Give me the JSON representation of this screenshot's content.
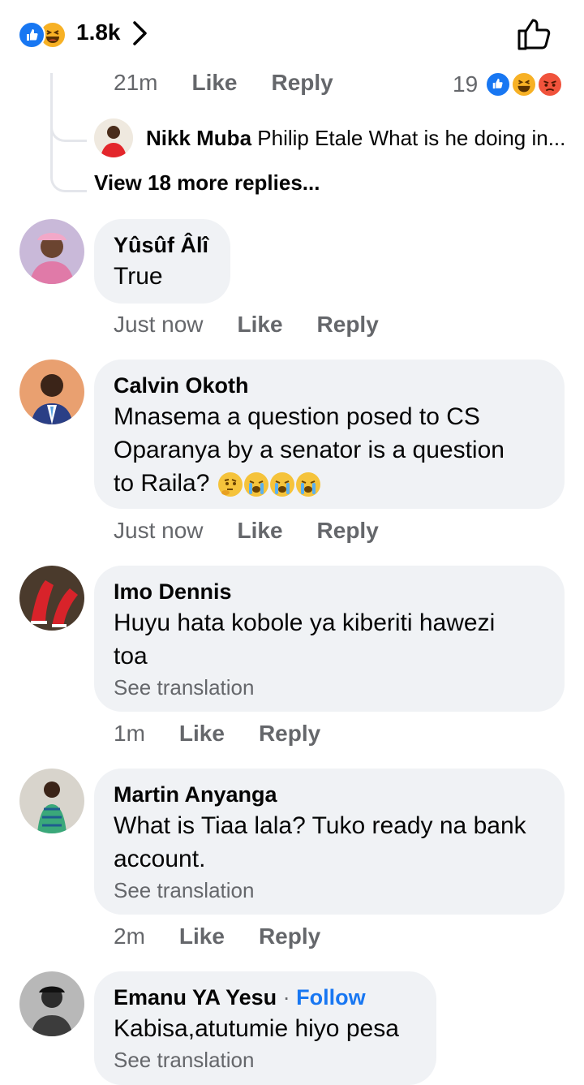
{
  "top": {
    "reaction_count": "1.8k"
  },
  "thread": {
    "time": "21m",
    "like": "Like",
    "reply": "Reply",
    "reaction_count": "19"
  },
  "nested_reply": {
    "name": "Nikk Muba",
    "text": "Philip Etale What is he doing in..."
  },
  "view_more": "View 18 more replies...",
  "comments": [
    {
      "name": "Yûsûf Âlî",
      "text": "True",
      "time": "Just now",
      "like": "Like",
      "reply": "Reply"
    },
    {
      "name": "Calvin Okoth",
      "text_line1": "Mnasema a question posed to CS",
      "text_line2": "Oparanya by a senator is a question",
      "text_line3": "to Raila?",
      "time": "Just now",
      "like": "Like",
      "reply": "Reply"
    },
    {
      "name": "Imo Dennis",
      "text_line1": "Huyu hata kobole ya kiberiti hawezi",
      "text_line2": "toa",
      "see_translation": "See translation",
      "time": "1m",
      "like": "Like",
      "reply": "Reply"
    },
    {
      "name": "Martin Anyanga",
      "text_line1": "What is Tiaa lala? Tuko ready na bank",
      "text_line2": "account.",
      "see_translation": "See translation",
      "time": "2m",
      "like": "Like",
      "reply": "Reply"
    },
    {
      "name": "Emanu YA Yesu",
      "separator": "·",
      "follow": "Follow",
      "text": "Kabisa,atutumie hiyo pesa",
      "see_translation": "See translation"
    }
  ],
  "colors": {
    "accent": "#1877f2",
    "bubble": "#f0f2f5",
    "secondary_text": "#65676b",
    "haha": "#f7b125",
    "angry": "#f0533c"
  },
  "icons": [
    "like-reaction-icon",
    "haha-reaction-icon",
    "angry-reaction-icon",
    "chevron-right-icon",
    "thumbs-up-outline-icon",
    "thinking-emoji-icon",
    "crying-emoji-icon"
  ]
}
